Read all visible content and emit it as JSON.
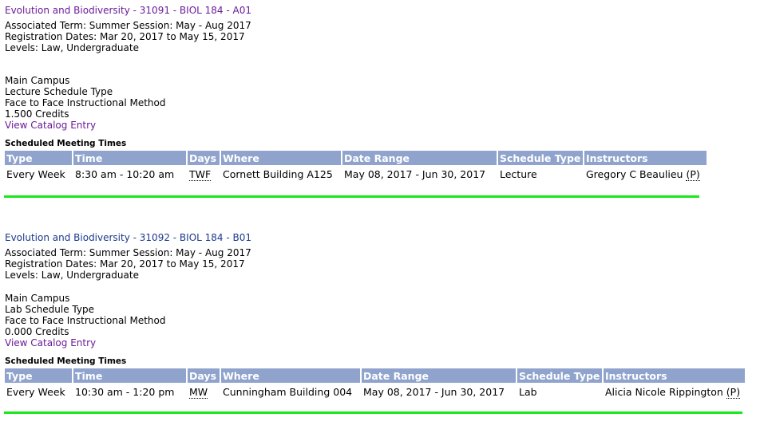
{
  "colors": {
    "link_visited": "#6b1b99",
    "link": "#1b3a8c",
    "header_bg": "#8fa3cd",
    "highlight": "#18e81a"
  },
  "sections": [
    {
      "title": "Evolution and Biodiversity - 31091 - BIOL 184 - A01",
      "term": "Associated Term: Summer Session: May - Aug 2017",
      "reg_dates": "Registration Dates: Mar 20, 2017 to May 15, 2017",
      "levels": "Levels: Law, Undergraduate",
      "campus": "Main Campus",
      "schedule_type": "Lecture Schedule Type",
      "method": "Face to Face Instructional Method",
      "credits": "1.500 Credits",
      "catalog_link": "View Catalog Entry",
      "meeting_label": "Scheduled Meeting Times",
      "headers": [
        "Type",
        "Time",
        "Days",
        "Where",
        "Date Range",
        "Schedule Type",
        "Instructors"
      ],
      "row": {
        "type": "Every Week",
        "time": "8:30 am - 10:20 am",
        "days": "TWF",
        "where": "Cornett Building A125",
        "date_range": "May 08, 2017 - Jun 30, 2017",
        "schedule_type": "Lecture",
        "instructor": "Gregory C Beaulieu",
        "primary_mark": "(P)"
      }
    },
    {
      "title": "Evolution and Biodiversity - 31092 - BIOL 184 - B01",
      "term": "Associated Term: Summer Session: May - Aug 2017",
      "reg_dates": "Registration Dates: Mar 20, 2017 to May 15, 2017",
      "levels": "Levels: Law, Undergraduate",
      "campus": "Main Campus",
      "schedule_type": "Lab Schedule Type",
      "method": "Face to Face Instructional Method",
      "credits": "0.000 Credits",
      "catalog_link": "View Catalog Entry",
      "meeting_label": "Scheduled Meeting Times",
      "headers": [
        "Type",
        "Time",
        "Days",
        "Where",
        "Date Range",
        "Schedule Type",
        "Instructors"
      ],
      "row": {
        "type": "Every Week",
        "time": "10:30 am - 1:20 pm",
        "days": "MW",
        "where": "Cunningham Building 004",
        "date_range": "May 08, 2017 - Jun 30, 2017",
        "schedule_type": "Lab",
        "instructor": "Alicia Nicole Rippington",
        "primary_mark": "(P)"
      }
    }
  ]
}
